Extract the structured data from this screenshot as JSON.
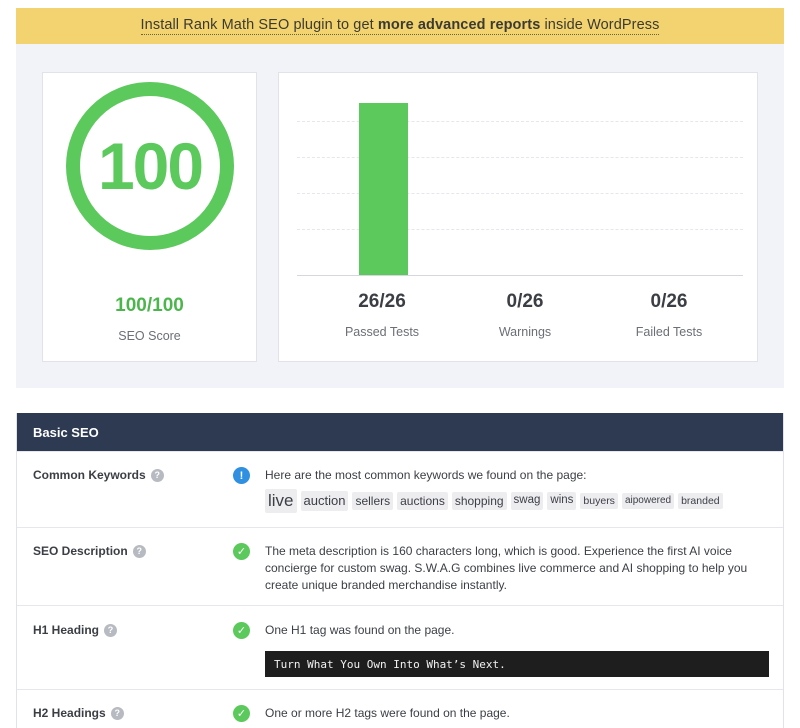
{
  "banner": {
    "prefix": "Install Rank Math SEO plugin to get ",
    "bold": "more advanced reports",
    "suffix": " inside WordPress"
  },
  "score": {
    "circle_value": "100",
    "value": "100/100",
    "label": "SEO Score",
    "color": "#5cc95c"
  },
  "tests": {
    "passed": {
      "value": "26/26",
      "label": "Passed Tests"
    },
    "warnings": {
      "value": "0/26",
      "label": "Warnings"
    },
    "failed": {
      "value": "0/26",
      "label": "Failed Tests"
    }
  },
  "chart_data": {
    "type": "bar",
    "categories": [
      "Passed Tests",
      "Warnings",
      "Failed Tests"
    ],
    "values": [
      26,
      0,
      0
    ],
    "ylim": [
      0,
      26
    ],
    "grid": true,
    "colors": [
      "#5cc95c",
      "#f0b849",
      "#e05252"
    ]
  },
  "section": {
    "title": "Basic SEO",
    "header_color": "#2d3a52",
    "rows": [
      {
        "label": "Common Keywords",
        "status": "info",
        "text": "Here are the most common keywords we found on the page:",
        "keywords": [
          {
            "word": "live",
            "size": 17
          },
          {
            "word": "auction",
            "size": 13
          },
          {
            "word": "sellers",
            "size": 12
          },
          {
            "word": "auctions",
            "size": 12
          },
          {
            "word": "shopping",
            "size": 12
          },
          {
            "word": "swag",
            "size": 11.5
          },
          {
            "word": "wins",
            "size": 11.5
          },
          {
            "word": "buyers",
            "size": 10.5
          },
          {
            "word": "aipowered",
            "size": 10
          },
          {
            "word": "branded",
            "size": 10.5
          }
        ]
      },
      {
        "label": "SEO Description",
        "status": "pass",
        "text": "The meta description is 160 characters long, which is good. Experience the first AI voice concierge for custom swag. S.W.A.G combines live commerce and AI shopping to help you create unique branded merchandise instantly."
      },
      {
        "label": "H1 Heading",
        "status": "pass",
        "text": "One H1 tag was found on the page.",
        "code": "Turn What You Own Into What’s Next."
      },
      {
        "label": "H2 Headings",
        "status": "pass",
        "text": "One or more H2 tags were found on the page."
      }
    ]
  }
}
